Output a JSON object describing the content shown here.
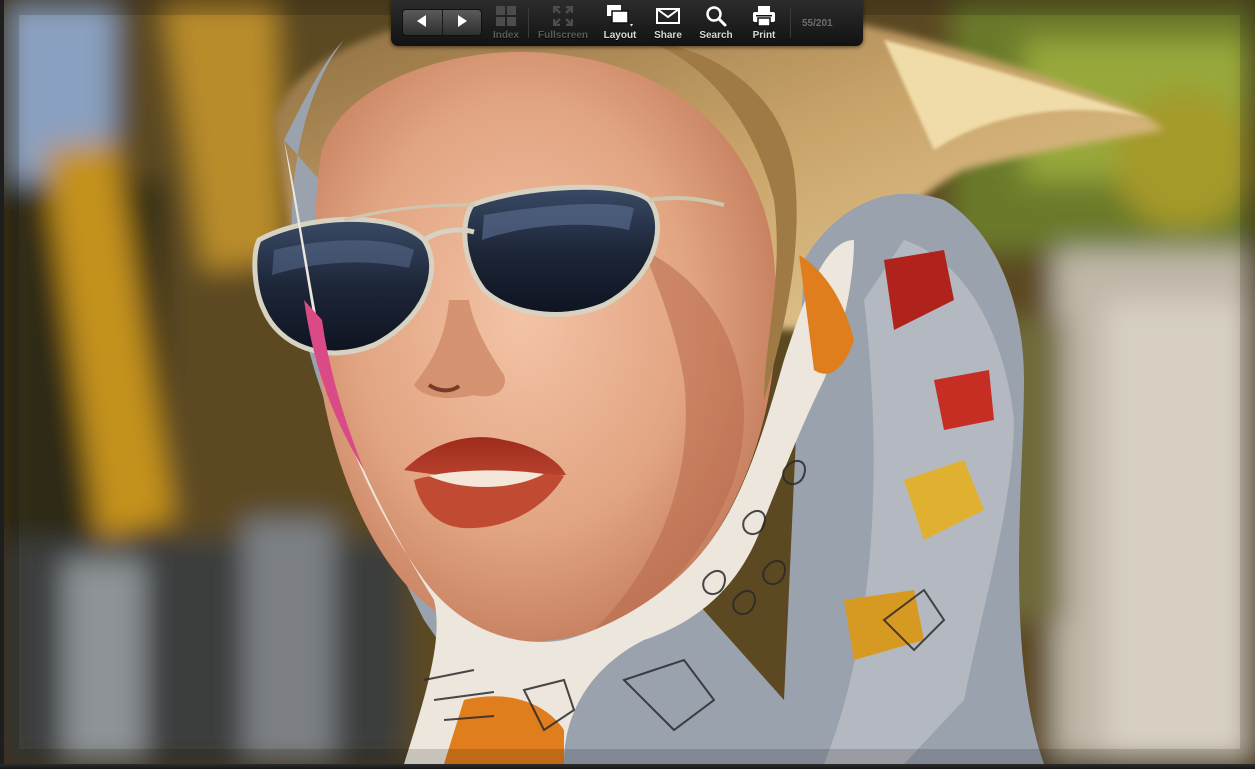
{
  "toolbar": {
    "prev_icon": "triangle-left-icon",
    "next_icon": "triangle-right-icon",
    "index_label": "Index",
    "fullscreen_label": "Fullscreen",
    "layout_label": "Layout",
    "share_label": "Share",
    "search_label": "Search",
    "print_label": "Print",
    "counter": "55/201"
  },
  "colors": {
    "toolbar_bg": "#1e1e1e",
    "label_active": "#d8d8d8",
    "label_disabled": "#5a5a5a"
  },
  "image": {
    "subject": "portrait-photo"
  }
}
